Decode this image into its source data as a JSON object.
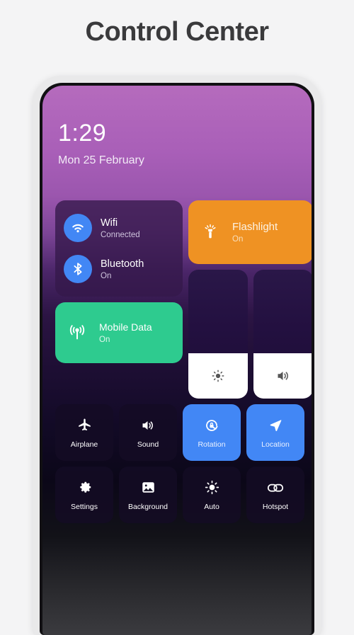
{
  "page": {
    "title": "Control Center",
    "background_color": "#f4f4f5",
    "title_color": "#3a3a3c"
  },
  "status": {
    "time": "1:29",
    "date": "Mon 25 February"
  },
  "connectivity_card": {
    "items": [
      {
        "icon": "wifi-icon",
        "label": "Wifi",
        "status": "Connected",
        "icon_color": "#4287f5"
      },
      {
        "icon": "bluetooth-icon",
        "label": "Bluetooth",
        "status": "On",
        "icon_color": "#4287f5"
      }
    ]
  },
  "mobile_data": {
    "icon": "cell-signal-icon",
    "label": "Mobile Data",
    "status": "On",
    "color": "#2ecb8f"
  },
  "flashlight": {
    "icon": "flashlight-icon",
    "label": "Flashlight",
    "status": "On",
    "color": "#ef9223"
  },
  "sliders": [
    {
      "name": "brightness-slider",
      "icon": "brightness-sun-icon",
      "fill_percent": 35
    },
    {
      "name": "volume-slider",
      "icon": "volume-speaker-icon",
      "fill_percent": 35
    }
  ],
  "toggles": [
    {
      "name": "airplane",
      "icon": "airplane-icon",
      "label": "Airplane",
      "active": false
    },
    {
      "name": "sound",
      "icon": "volume-speaker-icon",
      "label": "Sound",
      "active": false
    },
    {
      "name": "rotation",
      "icon": "rotation-lock-icon",
      "label": "Rotation",
      "active": true
    },
    {
      "name": "location",
      "icon": "location-arrow-icon",
      "label": "Location",
      "active": true
    },
    {
      "name": "settings",
      "icon": "gear-icon",
      "label": "Settings",
      "active": false
    },
    {
      "name": "background",
      "icon": "image-icon",
      "label": "Background",
      "active": false
    },
    {
      "name": "auto",
      "icon": "sun-icon",
      "label": "Auto",
      "active": false
    },
    {
      "name": "hotspot",
      "icon": "linked-rings-icon",
      "label": "Hotspot",
      "active": false
    }
  ],
  "accent_colors": {
    "blue": "#4287f5",
    "green": "#2ecb8f",
    "orange": "#ef9223",
    "purple_top": "#b56bbd"
  }
}
